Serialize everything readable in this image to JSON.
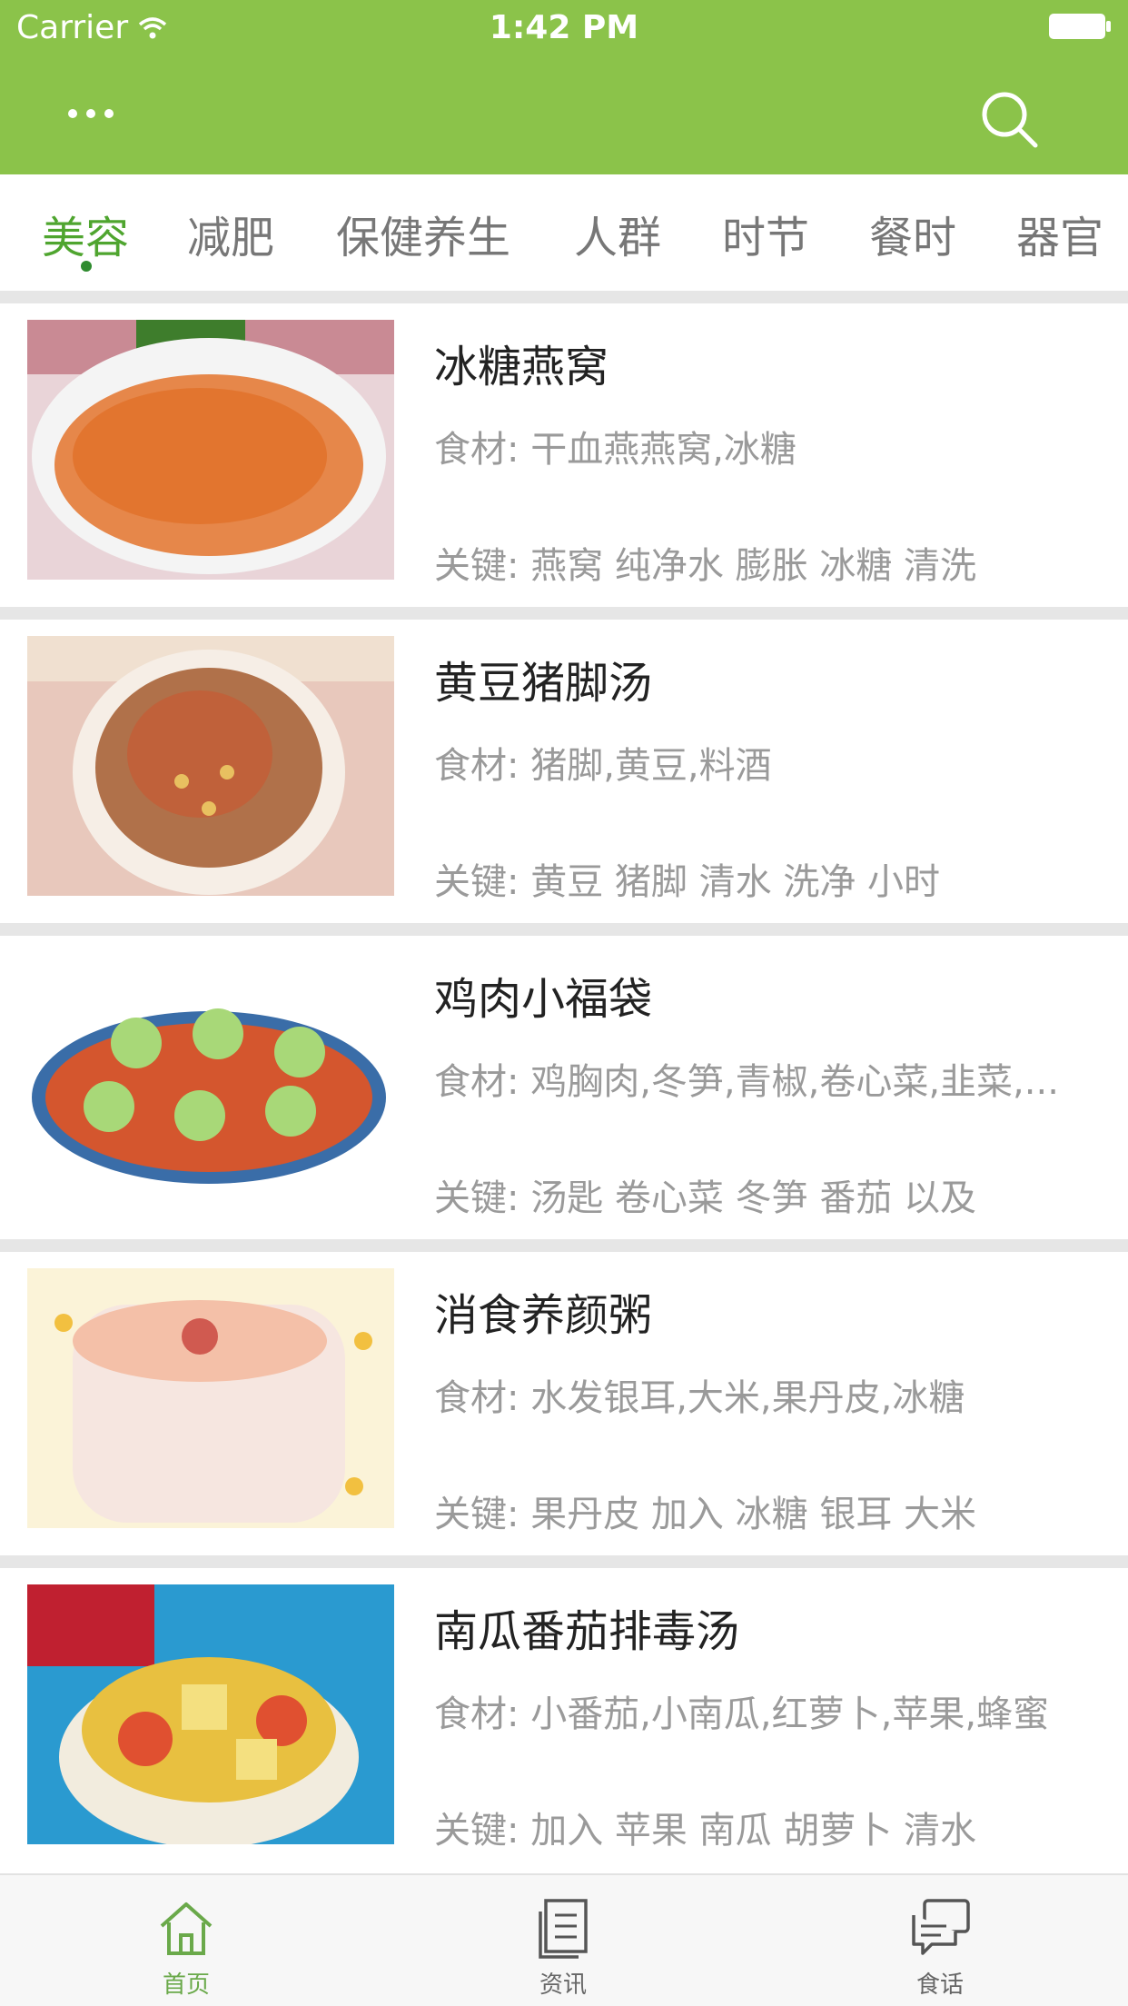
{
  "status_bar": {
    "carrier": "Carrier",
    "time": "1:42 PM"
  },
  "colors": {
    "header": "#8bc34a",
    "tab_active": "#4fa52f",
    "text_secondary": "#9a9a9a"
  },
  "tabs": [
    {
      "label": "美容",
      "active": true
    },
    {
      "label": "减肥"
    },
    {
      "label": "保健养生"
    },
    {
      "label": "人群"
    },
    {
      "label": "时节"
    },
    {
      "label": "餐时"
    },
    {
      "label": "器官"
    }
  ],
  "items": [
    {
      "title": "冰糖燕窝",
      "ingredients": "食材: 干血燕燕窝,冰糖",
      "keywords": "关键: 燕窝 纯净水 膨胀 冰糖 清洗"
    },
    {
      "title": "黄豆猪脚汤",
      "ingredients": "食材: 猪脚,黄豆,料酒",
      "keywords": "关键: 黄豆 猪脚 清水 洗净 小时"
    },
    {
      "title": "鸡肉小福袋",
      "ingredients": "食材: 鸡胸肉,冬笋,青椒,卷心菜,韭菜,...",
      "keywords": "关键: 汤匙 卷心菜 冬笋 番茄 以及"
    },
    {
      "title": "消食养颜粥",
      "ingredients": "食材: 水发银耳,大米,果丹皮,冰糖",
      "keywords": "关键: 果丹皮 加入 冰糖 银耳 大米"
    },
    {
      "title": "南瓜番茄排毒汤",
      "ingredients": "食材: 小番茄,小南瓜,红萝卜,苹果,蜂蜜",
      "keywords": "关键: 加入 苹果 南瓜 胡萝卜 清水"
    }
  ],
  "tabbar": [
    {
      "label": "首页",
      "icon": "home-icon",
      "active": true
    },
    {
      "label": "资讯",
      "icon": "news-icon"
    },
    {
      "label": "食话",
      "icon": "chat-icon"
    }
  ]
}
